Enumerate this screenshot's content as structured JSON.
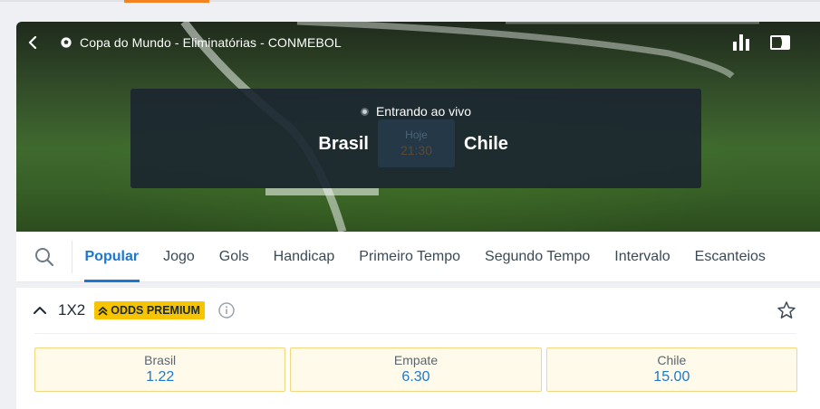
{
  "header": {
    "league_title": "Copa do Mundo - Eliminatórias - CONMEBOL",
    "icons": [
      "chevron-left-icon",
      "soccer-ball-icon",
      "bar-chart-icon",
      "screen-icon"
    ]
  },
  "scoreboard": {
    "status": "Entrando ao vivo",
    "home_team": "Brasil",
    "away_team": "Chile",
    "day": "Hoje",
    "time": "21:30"
  },
  "tabs": [
    {
      "label": "Popular",
      "active": true
    },
    {
      "label": "Jogo"
    },
    {
      "label": "Gols"
    },
    {
      "label": "Handicap"
    },
    {
      "label": "Primeiro Tempo"
    },
    {
      "label": "Segundo Tempo"
    },
    {
      "label": "Intervalo"
    },
    {
      "label": "Escanteios"
    }
  ],
  "market": {
    "title": "1X2",
    "badge": "ODDS PREMIUM",
    "odds": [
      {
        "label": "Brasil",
        "value": "1.22"
      },
      {
        "label": "Empate",
        "value": "6.30"
      },
      {
        "label": "Chile",
        "value": "15.00"
      }
    ]
  },
  "colors": {
    "accent": "#1b78d0",
    "brand_orange": "#f58220",
    "premium_yellow": "#f6c400",
    "scoreboard_bg": "#1b2630"
  }
}
